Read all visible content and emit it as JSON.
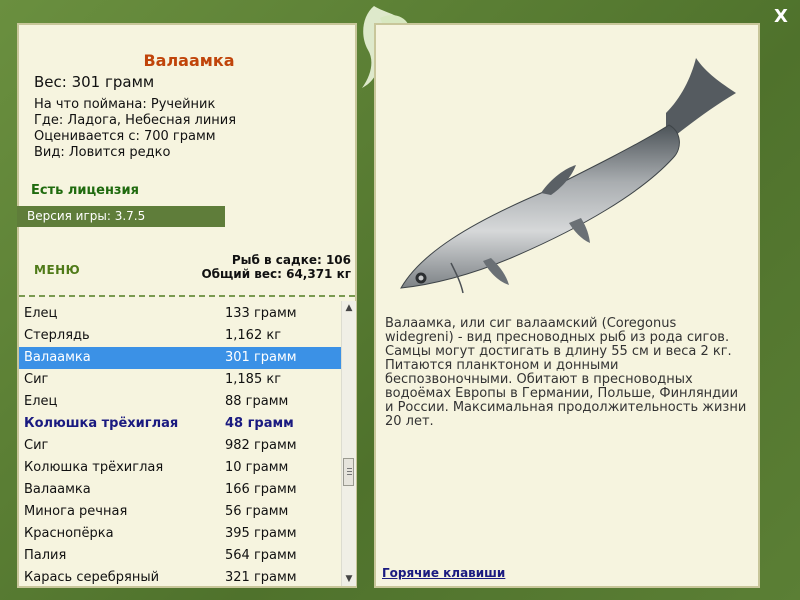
{
  "title": "Валаамка",
  "weight_line": "Вес: 301 грамм",
  "info": [
    "На что поймана: Ручейник",
    "Где: Ладога, Небесная линия",
    "Оценивается с: 700 грамм",
    "Вид: Ловится редко"
  ],
  "license": "Есть лицензия",
  "version": "Версия игры: 3.7.5",
  "menu_label": "МЕНЮ",
  "totals": {
    "fish_count": "Рыб в садке: 106",
    "total_weight": "Общий вес: 64,371 кг"
  },
  "list": [
    {
      "name": "Елец",
      "weight": "133 грамм",
      "state": ""
    },
    {
      "name": "Стерлядь",
      "weight": "1,162 кг",
      "state": ""
    },
    {
      "name": "Валаамка",
      "weight": "301 грамм",
      "state": "selected"
    },
    {
      "name": "Сиг",
      "weight": "1,185 кг",
      "state": ""
    },
    {
      "name": "Елец",
      "weight": "88 грамм",
      "state": ""
    },
    {
      "name": "Колюшка трёхиглая",
      "weight": "48 грамм",
      "state": "bold"
    },
    {
      "name": "Сиг",
      "weight": "982 грамм",
      "state": ""
    },
    {
      "name": "Колюшка трёхиглая",
      "weight": "10 грамм",
      "state": ""
    },
    {
      "name": "Валаамка",
      "weight": "166 грамм",
      "state": ""
    },
    {
      "name": "Минога речная",
      "weight": "56 грамм",
      "state": ""
    },
    {
      "name": "Краснопёрка",
      "weight": "395 грамм",
      "state": ""
    },
    {
      "name": "Палия",
      "weight": "564 грамм",
      "state": ""
    },
    {
      "name": "Карась серебряный",
      "weight": "321 грамм",
      "state": ""
    }
  ],
  "description": "Валаамка, или сиг валаамский (Coregonus widegreni) - вид пресноводных рыб из рода сигов. Самцы могут достигать в длину 55 см и веса 2 кг. Питаются планктоном и донными беспозвоночными. Обитают в пресноводных водоёмах Европы в Германии, Польше, Финляндии и России. Максимальная продолжительность жизни 20 лет.",
  "hotkeys": "Горячие клавиши",
  "close_label": "X",
  "colors": {
    "frame": "#5a7d34",
    "panel": "#f6f4df",
    "title": "#c0440a",
    "license": "#1f6a0e",
    "selected": "#3b91e6",
    "bold_item": "#1a1a80"
  },
  "icons": {
    "logo": "fish-logo-icon",
    "close": "close-icon",
    "scroll_up": "arrow-up-icon",
    "scroll_down": "arrow-down-icon"
  }
}
